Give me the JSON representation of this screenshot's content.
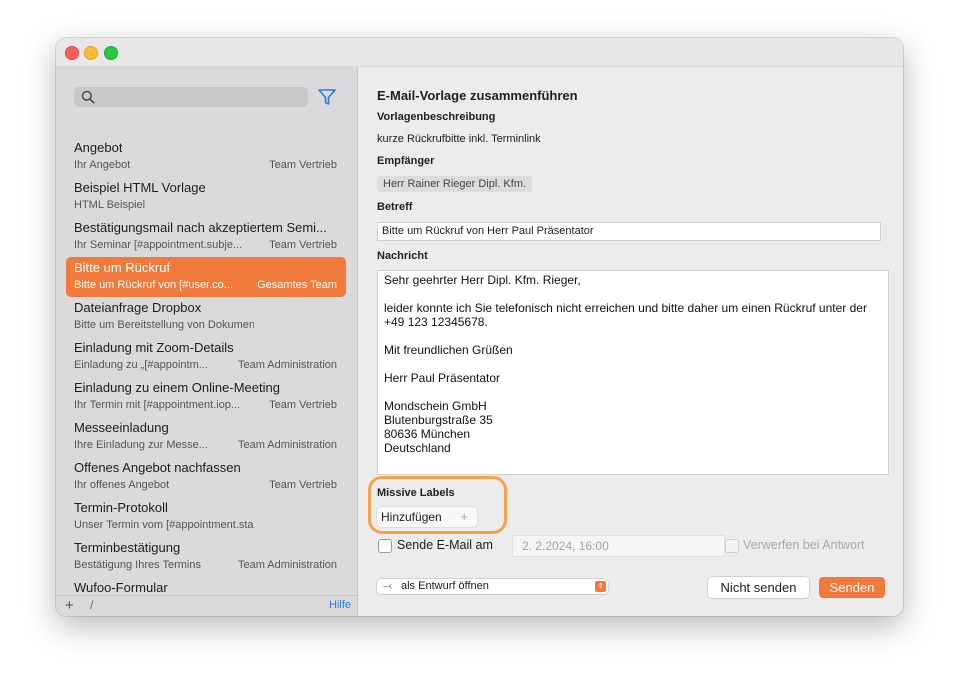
{
  "colors": {
    "accent": "#f07a3c",
    "highlight_ring": "#f5a24a",
    "filter_icon": "#2a7ae2",
    "help_link": "#2a7ae2"
  },
  "sidebar": {
    "search": {
      "placeholder": "",
      "value": ""
    },
    "items": [
      {
        "title": "Angebot",
        "subtitle": "Ihr Angebot",
        "team": "Team Vertrieb",
        "selected": false
      },
      {
        "title": "Beispiel HTML Vorlage",
        "subtitle": "HTML Beispiel",
        "team": "",
        "selected": false
      },
      {
        "title": "Bestätigungsmail nach akzeptiertem Semi...",
        "subtitle": "Ihr Seminar [#appointment.subje...",
        "team": "Team Vertrieb",
        "selected": false
      },
      {
        "title": "Bitte um Rückruf",
        "subtitle": "Bitte um Rückruf von [#user.co...",
        "team": "Gesamtes Team",
        "selected": true
      },
      {
        "title": "Dateianfrage Dropbox",
        "subtitle": "Bitte um Bereitstellung von Dokumenten",
        "team": "",
        "selected": false
      },
      {
        "title": "Einladung mit Zoom-Details",
        "subtitle": "Einladung zu „[#appointm...",
        "team": "Team Administration",
        "selected": false
      },
      {
        "title": "Einladung zu einem Online-Meeting",
        "subtitle": "Ihr Termin mit [#appointment.iop...",
        "team": "Team Vertrieb",
        "selected": false
      },
      {
        "title": "Messeeinladung",
        "subtitle": "Ihre Einladung zur Messe...",
        "team": "Team Administration",
        "selected": false
      },
      {
        "title": "Offenes Angebot nachfassen",
        "subtitle": "Ihr offenes Angebot",
        "team": "Team Vertrieb",
        "selected": false
      },
      {
        "title": "Termin-Protokoll",
        "subtitle": "Unser Termin vom [#appointment.startDate.io...",
        "team": "",
        "selected": false
      },
      {
        "title": "Terminbestätigung",
        "subtitle": "Bestätigung Ihres Termins",
        "team": "Team Administration",
        "selected": false
      },
      {
        "title": "Wufoo-Formular",
        "subtitle": "",
        "team": "",
        "selected": false
      }
    ],
    "bottom": {
      "add": "+",
      "edit": "/",
      "help": "Hilfe"
    }
  },
  "main": {
    "heading": "E-Mail-Vorlage zusammenführen",
    "description_label": "Vorlagenbeschreibung",
    "description_value": "kurze Rückrufbitte inkl. Terminlink",
    "recipient_label": "Empfänger",
    "recipient_chip": "Herr Rainer Rieger Dipl. Kfm.",
    "subject_label": "Betreff",
    "subject_value": "Bitte um Rückruf von Herr Paul Präsentator",
    "message_label": "Nachricht",
    "message": {
      "greeting": "Sehr geehrter Herr Dipl. Kfm. Rieger,",
      "body": "leider konnte ich Sie telefonisch nicht erreichen und bitte daher um einen Rückruf unter der +49 123 12345678.",
      "closing": "Mit freundlichen Grüßen",
      "name": "Herr Paul Präsentator",
      "company": "Mondschein GmbH",
      "street": "Blutenburgstraße 35",
      "city": "80636 München",
      "country": "Deutschland"
    },
    "labels_label": "Missive Labels",
    "add_label_button": "Hinzufügen",
    "add_label_plus": "+",
    "send_at_label": "Sende E-Mail am",
    "send_at_value": "2.  2.2024, 16:00",
    "discard_label": "Verwerfen bei Antwort",
    "action_popup": "als Entwurf öffnen",
    "cancel_button": "Nicht senden",
    "send_button": "Senden"
  }
}
